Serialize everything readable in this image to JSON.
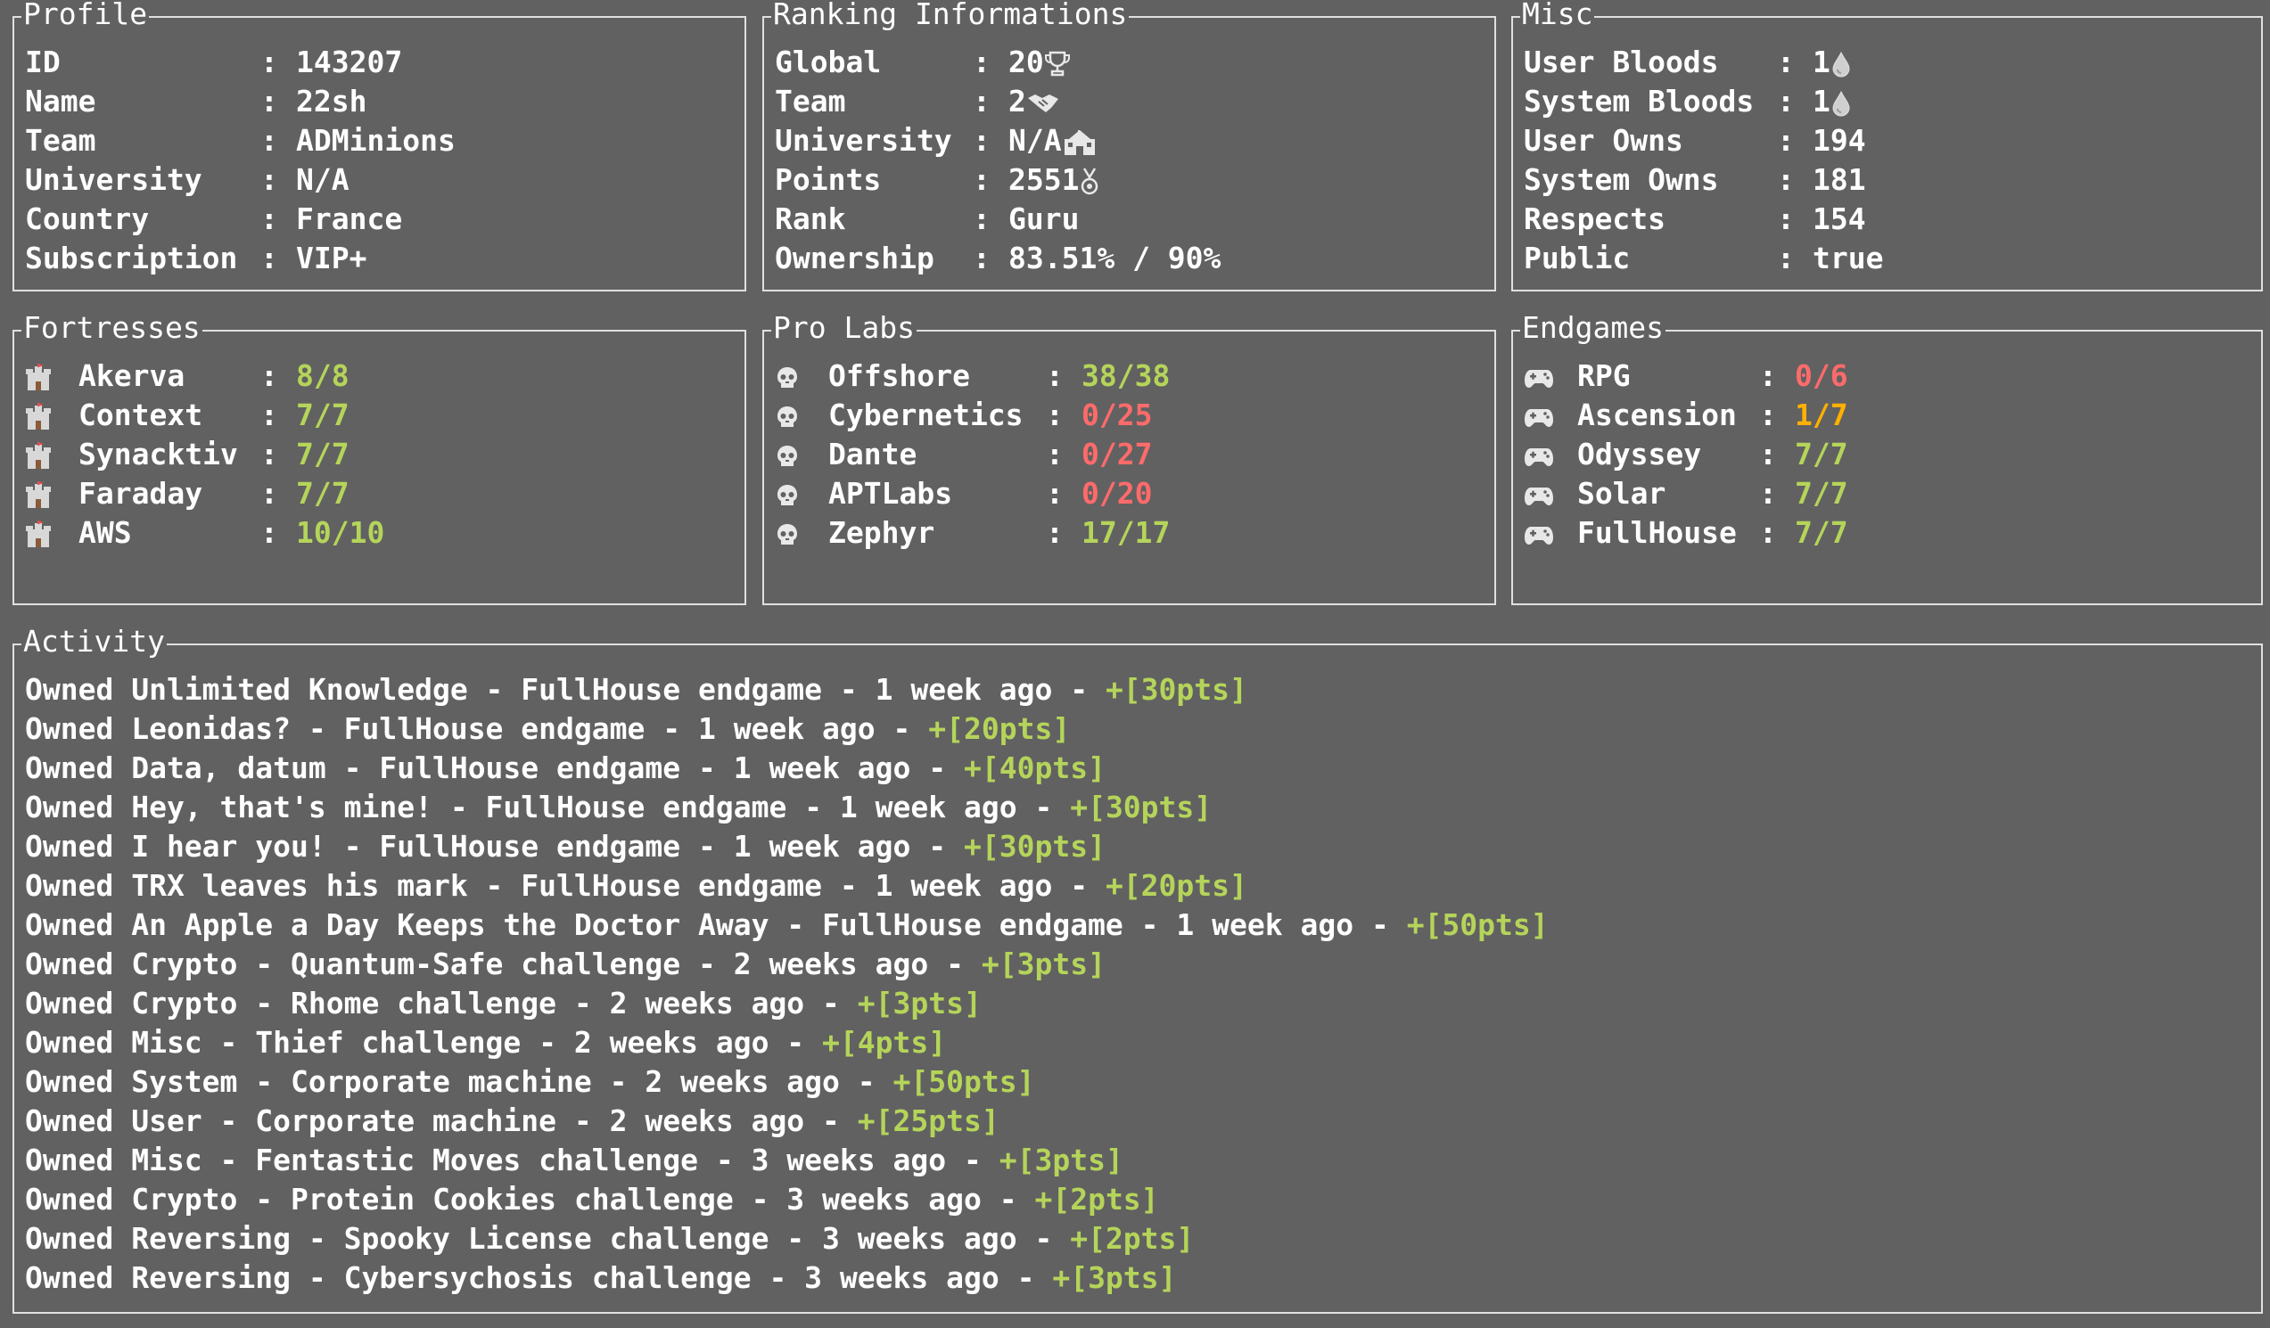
{
  "colors": {
    "background": "#616161",
    "border": "#e0e0e0",
    "text": "#ffffff",
    "good": "#b5d45a",
    "bad": "#ff6b6b",
    "partial": "#ffb000"
  },
  "profile": {
    "title": "Profile",
    "rows": [
      {
        "key": "ID",
        "value": "143207"
      },
      {
        "key": "Name",
        "value": "22sh"
      },
      {
        "key": "Team",
        "value": "ADMinions"
      },
      {
        "key": "University",
        "value": "N/A"
      },
      {
        "key": "Country",
        "value": "France"
      },
      {
        "key": "Subscription",
        "value": "VIP+"
      }
    ]
  },
  "ranking": {
    "title": "Ranking Informations",
    "rows": [
      {
        "key": "Global",
        "value": "20",
        "icon": "trophy-icon"
      },
      {
        "key": "Team",
        "value": "2",
        "icon": "handshake-icon"
      },
      {
        "key": "University",
        "value": "N/A",
        "icon": "school-icon"
      },
      {
        "key": "Points",
        "value": "2551",
        "icon": "medal-icon"
      },
      {
        "key": "Rank",
        "value": "Guru"
      },
      {
        "key": "Ownership",
        "value": "83.51% / 90%"
      }
    ]
  },
  "misc": {
    "title": "Misc",
    "rows": [
      {
        "key": "User Bloods",
        "value": "1",
        "icon": "blood-drop-icon"
      },
      {
        "key": "System Bloods",
        "value": "1",
        "icon": "blood-drop-icon"
      },
      {
        "key": "User Owns",
        "value": "194"
      },
      {
        "key": "System Owns",
        "value": "181"
      },
      {
        "key": "Respects",
        "value": "154"
      },
      {
        "key": "Public",
        "value": "true"
      }
    ]
  },
  "fortresses": {
    "title": "Fortresses",
    "icon": "castle-icon",
    "rows": [
      {
        "key": "Akerva",
        "value": "8/8",
        "status": "green"
      },
      {
        "key": "Context",
        "value": "7/7",
        "status": "green"
      },
      {
        "key": "Synacktiv",
        "value": "7/7",
        "status": "green"
      },
      {
        "key": "Faraday",
        "value": "7/7",
        "status": "green"
      },
      {
        "key": "AWS",
        "value": "10/10",
        "status": "green"
      }
    ]
  },
  "prolabs": {
    "title": "Pro Labs",
    "icon": "skull-icon",
    "rows": [
      {
        "key": "Offshore",
        "value": "38/38",
        "status": "green"
      },
      {
        "key": "Cybernetics",
        "value": "0/25",
        "status": "red"
      },
      {
        "key": "Dante",
        "value": "0/27",
        "status": "red"
      },
      {
        "key": "APTLabs",
        "value": "0/20",
        "status": "red"
      },
      {
        "key": "Zephyr",
        "value": "17/17",
        "status": "green"
      }
    ]
  },
  "endgames": {
    "title": "Endgames",
    "icon": "gamepad-icon",
    "rows": [
      {
        "key": "RPG",
        "value": "0/6",
        "status": "red"
      },
      {
        "key": "Ascension",
        "value": "1/7",
        "status": "orange"
      },
      {
        "key": "Odyssey",
        "value": "7/7",
        "status": "green"
      },
      {
        "key": "Solar",
        "value": "7/7",
        "status": "green"
      },
      {
        "key": "FullHouse",
        "value": "7/7",
        "status": "green"
      }
    ]
  },
  "activity": {
    "title": "Activity",
    "rows": [
      {
        "text": "Owned Unlimited Knowledge - FullHouse endgame - 1 week ago - ",
        "pts": "+[30pts]"
      },
      {
        "text": "Owned Leonidas? - FullHouse endgame - 1 week ago - ",
        "pts": "+[20pts]"
      },
      {
        "text": "Owned Data, datum - FullHouse endgame - 1 week ago - ",
        "pts": "+[40pts]"
      },
      {
        "text": "Owned Hey, that's mine! - FullHouse endgame - 1 week ago - ",
        "pts": "+[30pts]"
      },
      {
        "text": "Owned I hear you! - FullHouse endgame - 1 week ago - ",
        "pts": "+[30pts]"
      },
      {
        "text": "Owned TRX leaves his mark - FullHouse endgame - 1 week ago - ",
        "pts": "+[20pts]"
      },
      {
        "text": "Owned An Apple a Day Keeps the Doctor Away - FullHouse endgame - 1 week ago - ",
        "pts": "+[50pts]"
      },
      {
        "text": "Owned Crypto - Quantum-Safe challenge - 2 weeks ago - ",
        "pts": "+[3pts]"
      },
      {
        "text": "Owned Crypto - Rhome challenge - 2 weeks ago - ",
        "pts": "+[3pts]"
      },
      {
        "text": "Owned Misc - Thief challenge - 2 weeks ago - ",
        "pts": "+[4pts]"
      },
      {
        "text": "Owned System - Corporate machine - 2 weeks ago - ",
        "pts": "+[50pts]"
      },
      {
        "text": "Owned User - Corporate machine - 2 weeks ago - ",
        "pts": "+[25pts]"
      },
      {
        "text": "Owned Misc - Fentastic Moves challenge - 3 weeks ago - ",
        "pts": "+[3pts]"
      },
      {
        "text": "Owned Crypto - Protein Cookies challenge - 3 weeks ago - ",
        "pts": "+[2pts]"
      },
      {
        "text": "Owned Reversing - Spooky License challenge - 3 weeks ago - ",
        "pts": "+[2pts]"
      },
      {
        "text": "Owned Reversing - Cybersychosis challenge - 3 weeks ago - ",
        "pts": "+[3pts]"
      }
    ]
  }
}
